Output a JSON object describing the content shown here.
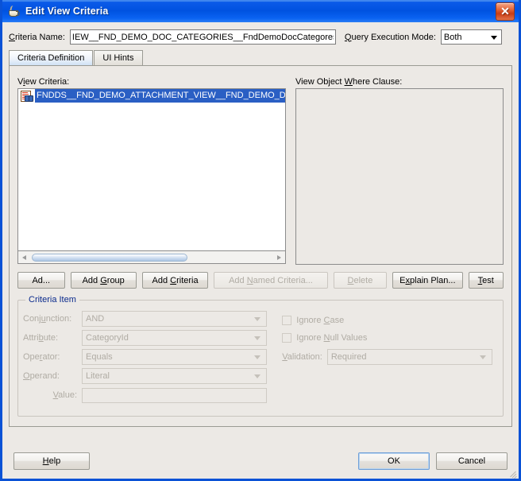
{
  "window": {
    "title": "Edit View Criteria",
    "icon": "java-cup-icon",
    "close_label": "✕"
  },
  "header": {
    "criteria_name_label": "Criteria Name:",
    "criteria_name_value": "IEW__FND_DEMO_DOC_CATEGORIES__FndDemoDocCategoresEO",
    "criteria_name_placeholder": "",
    "query_execution_mode_label": "Query Execution Mode:",
    "query_execution_mode_value": "Both"
  },
  "tabs": [
    {
      "label": "Criteria Definition",
      "active": true
    },
    {
      "label": "UI Hints",
      "active": false
    }
  ],
  "panels": {
    "view_criteria_label": "View Criteria:",
    "tree_items": [
      {
        "label": "FNDDS__FND_DEMO_ATTACHMENT_VIEW__FND_DEMO_DOC_C",
        "icon": "view-criteria-icon",
        "selected": true
      }
    ],
    "where_clause_label": "View Object Where Clause:",
    "where_clause_value": ""
  },
  "action_buttons": [
    {
      "id": "add",
      "label": "Ad...",
      "disabled": false
    },
    {
      "id": "add_group",
      "label": "Add Group",
      "disabled": false
    },
    {
      "id": "add_criteria",
      "label": "Add Criteria",
      "disabled": false
    },
    {
      "id": "add_named",
      "label": "Add Named Criteria...",
      "disabled": true
    },
    {
      "id": "delete",
      "label": "Delete",
      "disabled": true
    },
    {
      "id": "explain",
      "label": "Explain Plan...",
      "disabled": false
    },
    {
      "id": "test",
      "label": "Test",
      "disabled": false
    }
  ],
  "criteria_item": {
    "group_title": "Criteria Item",
    "fields": [
      {
        "id": "conjunction",
        "label": "Conjunction:",
        "value": "AND",
        "disabled": true
      },
      {
        "id": "attribute",
        "label": "Attribute:",
        "value": "CategoryId",
        "disabled": true
      },
      {
        "id": "operator",
        "label": "Operator:",
        "value": "Equals",
        "disabled": true
      },
      {
        "id": "operand",
        "label": "Operand:",
        "value": "Literal",
        "disabled": true
      }
    ],
    "value_label": "Value:",
    "value_text": "",
    "ignore_case_label": "Ignore Case",
    "ignore_case_checked": false,
    "ignore_null_label": "Ignore Null Values",
    "ignore_null_checked": false,
    "validation_label": "Validation:",
    "validation_value": "Required"
  },
  "footer": {
    "help_label": "Help",
    "ok_label": "OK",
    "cancel_label": "Cancel"
  },
  "colors": {
    "titlebar_blue": "#0052e0",
    "selection_blue": "#2a5fc4",
    "dialog_bg": "#ece9e5",
    "group_title": "#0a2a8c",
    "disabled_text": "#b0aca4",
    "close_red": "#c93d14"
  }
}
